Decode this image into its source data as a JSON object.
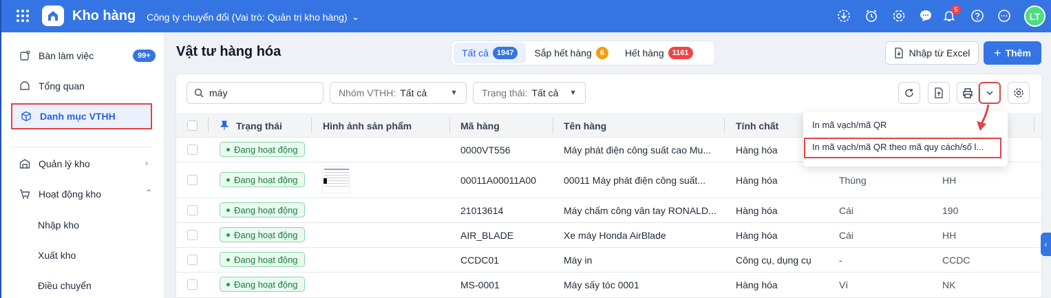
{
  "header": {
    "app_title": "Kho hàng",
    "company": "Công ty chuyển đổi (Vai trò: Quản trị kho hàng)",
    "notification_count": "5",
    "avatar_initials": "LT"
  },
  "sidebar": {
    "items": [
      {
        "label": "Bàn làm việc",
        "badge": "99+"
      },
      {
        "label": "Tổng quan"
      },
      {
        "label": "Danh mục VTHH"
      },
      {
        "label": "Quản lý kho"
      },
      {
        "label": "Hoạt động kho"
      }
    ],
    "sub_items": [
      "Nhập kho",
      "Xuất kho",
      "Điều chuyển"
    ]
  },
  "page": {
    "title": "Vật tư hàng hóa",
    "tabs": [
      {
        "label": "Tất cả",
        "count": "1947"
      },
      {
        "label": "Sắp hết hàng",
        "count": "6"
      },
      {
        "label": "Hết hàng",
        "count": "1161"
      }
    ],
    "import_label": "Nhập từ Excel",
    "add_label": "Thêm"
  },
  "filters": {
    "search_value": "máy",
    "group_label": "Nhóm VTHH:",
    "group_value": "Tất cả",
    "status_label": "Trạng thái:",
    "status_value": "Tất cả"
  },
  "table": {
    "columns": [
      "Trạng thái",
      "Hình ảnh sản phẩm",
      "Mã hàng",
      "Tên hàng",
      "Tính chất"
    ],
    "rows": [
      {
        "status": "Đang hoạt động",
        "code": "0000VT556",
        "name": "Máy phát điện công suất cao Mu...",
        "type": "Hàng hóa",
        "unit": "",
        "extra": ""
      },
      {
        "status": "Đang hoạt động",
        "code": "00011A00011A00",
        "name": "00011 Máy phát điện công suất...",
        "type": "Hàng hóa",
        "unit": "Thùng",
        "extra": "HH"
      },
      {
        "status": "Đang hoạt động",
        "code": "21013614",
        "name": "Máy chấm công vân tay RONALD...",
        "type": "Hàng hóa",
        "unit": "Cái",
        "extra": "190"
      },
      {
        "status": "Đang hoạt động",
        "code": "AIR_BLADE",
        "name": "Xe máy Honda AirBlade",
        "type": "Hàng hóa",
        "unit": "Cái",
        "extra": "HH"
      },
      {
        "status": "Đang hoạt động",
        "code": "CCDC01",
        "name": "Máy in",
        "type": "Công cụ, dụng cụ",
        "unit": "-",
        "extra": "CCDC"
      },
      {
        "status": "Đang hoạt động",
        "code": "MS-0001",
        "name": "Máy sấy tóc 0001",
        "type": "Hàng hóa",
        "unit": "Ví",
        "extra": "NK"
      }
    ]
  },
  "print_menu": {
    "items": [
      "In mã vạch/mã QR",
      "In mã vạch/mã QR theo mã quy cách/số l..."
    ]
  },
  "colors": {
    "primary": "#3574e3",
    "highlight": "#e04444",
    "status_green": "#15803d"
  }
}
